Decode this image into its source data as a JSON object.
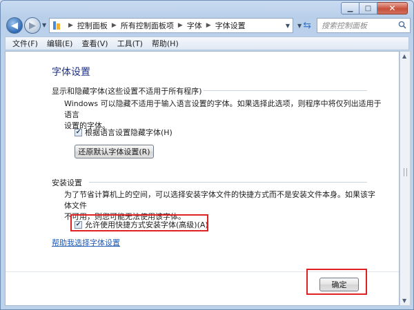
{
  "window": {
    "caption_buttons": {
      "minimize_icon": "minimize-icon",
      "maximize_icon": "maximize-icon",
      "close_icon": "close-icon"
    }
  },
  "nav": {
    "breadcrumbs": [
      "控制面板",
      "所有控制面板项",
      "字体",
      "字体设置"
    ],
    "search_placeholder": "搜索控制面板"
  },
  "menu": {
    "items": [
      "文件(F)",
      "编辑(E)",
      "查看(V)",
      "工具(T)",
      "帮助(H)"
    ]
  },
  "main": {
    "title": "字体设置",
    "show_hide": {
      "heading": "显示和隐藏字体(这些设置不适用于所有程序)",
      "description_line1": "Windows 可以隐藏不适用于输入语言设置的字体。如果选择此选项，则程序中将仅列出适用于语言",
      "description_line2": "设置的字体。",
      "checkbox_label": "根据语言设置隐藏字体(H)",
      "checkbox_checked": true,
      "restore_button": "还原默认字体设置(R)"
    },
    "install": {
      "heading": "安装设置",
      "description_line1": "为了节省计算机上的空间，可以选择安装字体文件的快捷方式而不是安装文件本身。如果该字体文件",
      "description_line2": "不可用，则您可能无法使用该字体。",
      "checkbox_label": "允许使用快捷方式安装字体(高级)(A)",
      "checkbox_checked": true
    },
    "help_link": "帮助我选择字体设置"
  },
  "footer": {
    "ok_button": "确定"
  },
  "colors": {
    "highlight": "#e02020",
    "title": "#1e3287",
    "link": "#1f5bb6"
  }
}
